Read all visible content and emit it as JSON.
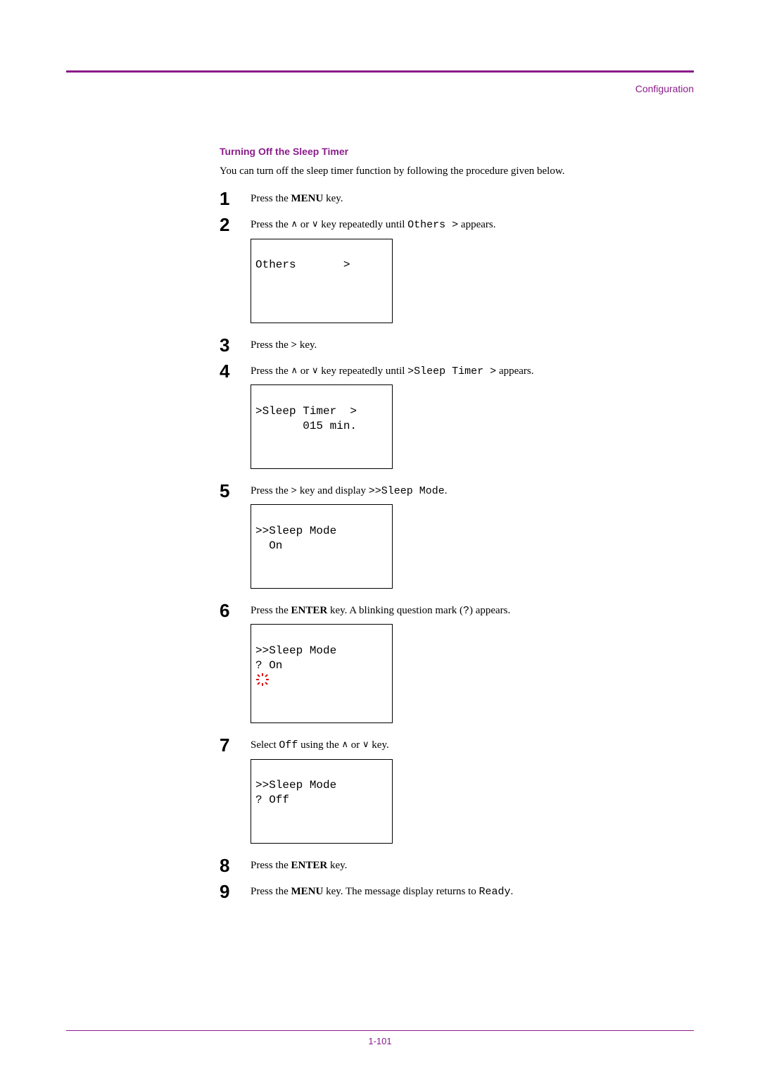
{
  "header": {
    "label": "Configuration"
  },
  "section": {
    "heading": "Turning Off the Sleep Timer"
  },
  "intro": "You can turn off the sleep timer function by following the procedure given below.",
  "steps": {
    "s1": {
      "num": "1",
      "pre": "Press the ",
      "bold": "MENU",
      "post": " key."
    },
    "s2": {
      "num": "2",
      "pre": "Press the ",
      "mid": " or ",
      "post1": " key repeatedly until ",
      "mono": "Others >",
      "post2": " appears.",
      "lcd_l1": "Others       >",
      "lcd_l2": " "
    },
    "s3": {
      "num": "3",
      "pre": "Press the ",
      "bold": ">",
      "post": " key."
    },
    "s4": {
      "num": "4",
      "pre": "Press the ",
      "mid": " or ",
      "post1": " key repeatedly until ",
      "mono": ">Sleep Timer >",
      "post2": " appears.",
      "lcd_l1": ">Sleep Timer  >",
      "lcd_l2": "       015 min."
    },
    "s5": {
      "num": "5",
      "pre": "Press the ",
      "bold": ">",
      "mid": " key and display ",
      "mono": ">>Sleep Mode",
      "post": ".",
      "lcd_l1": ">>Sleep Mode",
      "lcd_l2": "  On"
    },
    "s6": {
      "num": "6",
      "pre": "Press the ",
      "bold": "ENTER",
      "post1": " key. A blinking question mark (",
      "mono": "?",
      "post2": ") appears.",
      "lcd_l1": ">>Sleep Mode",
      "lcd_l2": "? On"
    },
    "s7": {
      "num": "7",
      "pre": "Select ",
      "mono": "Off",
      "mid1": " using the ",
      "mid2": " or ",
      "post": " key.",
      "lcd_l1": ">>Sleep Mode",
      "lcd_l2": "? Off"
    },
    "s8": {
      "num": "8",
      "pre": "Press the ",
      "bold": "ENTER",
      "post": " key."
    },
    "s9": {
      "num": "9",
      "pre": "Press the ",
      "bold": "MENU",
      "mid": " key. The message display returns to ",
      "mono": "Ready",
      "post": "."
    }
  },
  "footer": {
    "page": "1-101"
  },
  "glyphs": {
    "up": "∧",
    "down": "∨"
  }
}
